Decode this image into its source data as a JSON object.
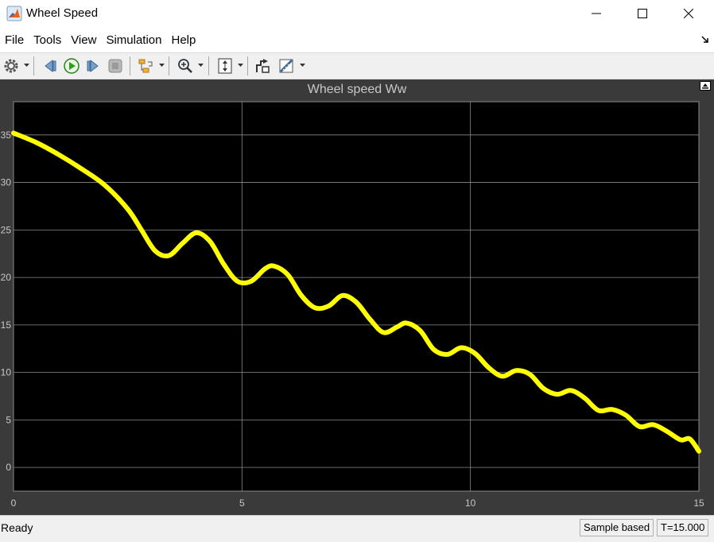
{
  "window": {
    "title": "Wheel Speed",
    "controls": [
      "minimize",
      "maximize",
      "close"
    ]
  },
  "menu": {
    "items": [
      "File",
      "Tools",
      "View",
      "Simulation",
      "Help"
    ]
  },
  "toolbar": {
    "buttons": [
      {
        "name": "configuration-properties",
        "icon": "gear-icon",
        "dropdown": true
      },
      {
        "name": "step-back",
        "icon": "step-back-icon"
      },
      {
        "name": "run",
        "icon": "run-icon"
      },
      {
        "name": "step-forward",
        "icon": "step-forward-icon"
      },
      {
        "name": "stop",
        "icon": "stop-icon"
      },
      {
        "name": "triggers",
        "icon": "trigger-icon",
        "dropdown": true
      },
      {
        "name": "zoom",
        "icon": "zoom-icon",
        "dropdown": true
      },
      {
        "name": "scale-axes",
        "icon": "scale-axes-icon",
        "dropdown": true
      },
      {
        "name": "highlight-simulink-block",
        "icon": "highlight-block-icon"
      },
      {
        "name": "measurements",
        "icon": "measure-icon",
        "dropdown": true
      }
    ]
  },
  "colors": {
    "scope_background": "#3a3a3a",
    "axes_background": "#000000",
    "grid": "#8a8a8a",
    "line": "#ffff00",
    "text": "#c8c8c8"
  },
  "chart_data": {
    "type": "line",
    "title": "Wheel speed Ww",
    "xlabel": "",
    "ylabel": "",
    "xlim": [
      0,
      15
    ],
    "ylim": [
      -2.5,
      38.5
    ],
    "xticks": [
      "0",
      "5",
      "10",
      "15"
    ],
    "yticks": [
      "0",
      "5",
      "10",
      "15",
      "20",
      "25",
      "30",
      "35"
    ],
    "grid": true,
    "series": [
      {
        "values_x": [
          0,
          0.5,
          1,
          1.5,
          2,
          2.5,
          2.8,
          3.1,
          3.4,
          3.7,
          4.0,
          4.3,
          4.6,
          4.9,
          5.2,
          5.5,
          5.7,
          6.0,
          6.3,
          6.6,
          6.9,
          7.2,
          7.5,
          7.8,
          8.1,
          8.4,
          8.6,
          8.9,
          9.2,
          9.5,
          9.8,
          10.1,
          10.4,
          10.7,
          11.0,
          11.3,
          11.6,
          11.9,
          12.2,
          12.5,
          12.8,
          13.1,
          13.4,
          13.7,
          14.0,
          14.3,
          14.6,
          14.8,
          15.0
        ],
        "values_y": [
          35.2,
          34.2,
          32.9,
          31.4,
          29.7,
          27.2,
          25.0,
          22.8,
          22.3,
          23.6,
          24.7,
          23.8,
          21.4,
          19.6,
          19.6,
          20.9,
          21.2,
          20.3,
          18.1,
          16.8,
          17.0,
          18.1,
          17.4,
          15.6,
          14.2,
          14.8,
          15.2,
          14.4,
          12.4,
          11.9,
          12.6,
          12.0,
          10.5,
          9.6,
          10.2,
          9.8,
          8.3,
          7.7,
          8.1,
          7.3,
          6.0,
          6.1,
          5.5,
          4.3,
          4.5,
          3.8,
          2.9,
          3.0,
          1.7
        ]
      }
    ]
  },
  "status": {
    "ready": "Ready",
    "mode": "Sample based",
    "time": "T=15.000"
  }
}
